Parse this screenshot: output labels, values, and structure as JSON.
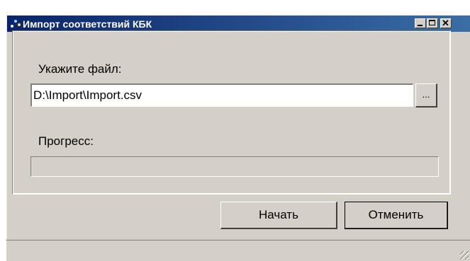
{
  "window": {
    "title": "Импорт соответствий КБК",
    "icon": "import-app-icon",
    "controls": {
      "minimize": "minimize-icon",
      "maximize": "maximize-icon",
      "close_glyph": "✕"
    }
  },
  "form": {
    "file_label": "Укажите файл:",
    "file_value": "D:\\Import\\Import.csv",
    "browse_label": "...",
    "progress_label": "Прогресс:",
    "progress_percent": 0
  },
  "buttons": {
    "start_label": "Начать",
    "cancel_label": "Отменить"
  },
  "colors": {
    "titlebar_start": "#0a246a",
    "titlebar_end": "#3a6ea5",
    "face": "#d4d0c8"
  }
}
